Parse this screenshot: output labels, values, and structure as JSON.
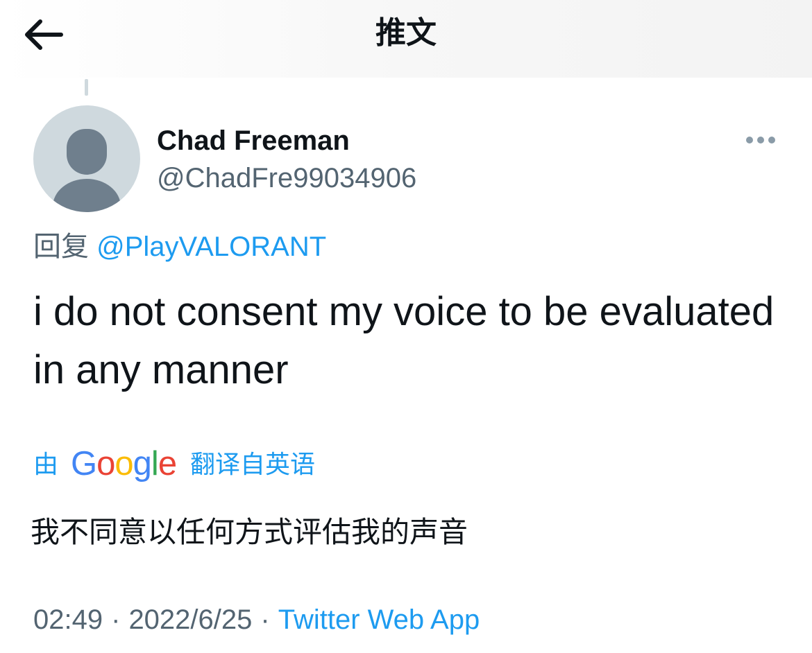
{
  "header": {
    "title": "推文",
    "back_icon": "arrow-left-icon"
  },
  "tweet": {
    "author": {
      "display_name": "Chad Freeman",
      "handle": "@ChadFre99034906",
      "avatar_icon": "default-avatar-icon"
    },
    "more_icon": "more-dots-icon",
    "reply_prefix": "回复",
    "reply_to": "@PlayVALORANT",
    "text": "i do not consent my voice to be evaluated in any manner",
    "translation": {
      "prefix": "由",
      "provider": "Google",
      "suffix": "翻译自英语",
      "text": "我不同意以任何方式评估我的声音"
    },
    "time": "02:49",
    "separator": "·",
    "date": "2022/6/25",
    "source": "Twitter Web App"
  },
  "colors": {
    "text_primary": "#0f1419",
    "text_secondary": "#536471",
    "accent": "#1d9bf0",
    "avatar_bg": "#cfd9de",
    "avatar_fg": "#6f7f8d",
    "google_blue": "#4285f4",
    "google_red": "#ea4335",
    "google_yellow": "#fbbc05",
    "google_green": "#34a853"
  }
}
